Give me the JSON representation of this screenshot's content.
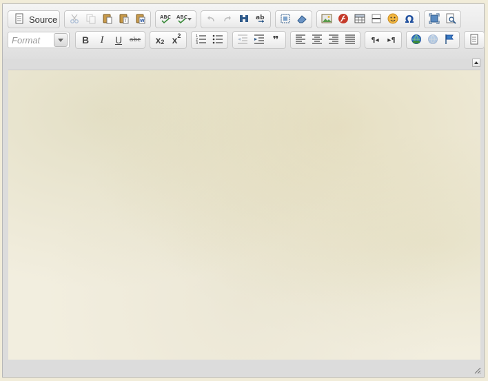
{
  "toolbar": {
    "source_label": "Source",
    "format_placeholder": "Format",
    "bold_label": "B",
    "italic_label": "I",
    "underline_label": "U",
    "strike_label": "abc",
    "subscript_label": "x",
    "subscript_suffix": "2",
    "superscript_label": "x",
    "superscript_suffix": "2",
    "blockquote_label": "❞"
  },
  "colors": {
    "toolbar_bg": "#dedede",
    "content_bg": "#f2eedf",
    "icon_blue": "#1f63a6",
    "icon_green": "#3a7d3a"
  }
}
